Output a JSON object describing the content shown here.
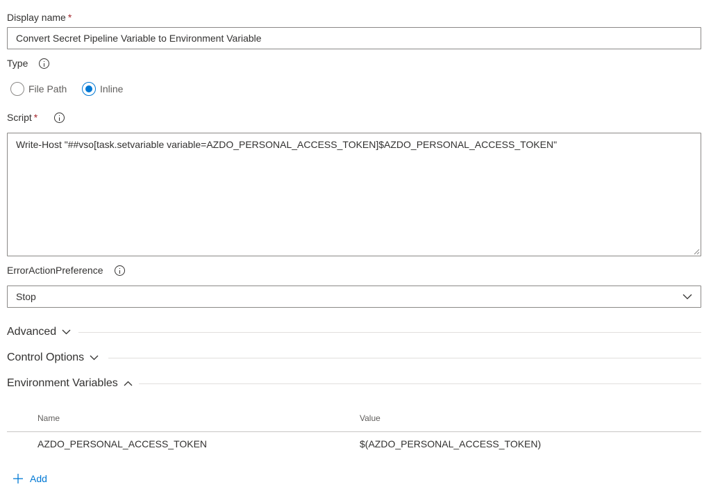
{
  "display_name": {
    "label": "Display name",
    "required_marker": "*",
    "value": "Convert Secret Pipeline Variable to Environment Variable"
  },
  "type": {
    "label": "Type",
    "options": [
      {
        "label": "File Path",
        "selected": false
      },
      {
        "label": "Inline",
        "selected": true
      }
    ]
  },
  "script": {
    "label": "Script",
    "required_marker": "*",
    "value": "Write-Host \"##vso[task.setvariable variable=AZDO_PERSONAL_ACCESS_TOKEN]$AZDO_PERSONAL_ACCESS_TOKEN\""
  },
  "error_action": {
    "label": "ErrorActionPreference",
    "selected": "Stop"
  },
  "sections": {
    "advanced": {
      "label": "Advanced",
      "expanded": false
    },
    "control_options": {
      "label": "Control Options",
      "expanded": false
    },
    "environment_variables": {
      "label": "Environment Variables",
      "expanded": true
    }
  },
  "env_table": {
    "columns": [
      "Name",
      "Value"
    ],
    "rows": [
      {
        "name": "AZDO_PERSONAL_ACCESS_TOKEN",
        "value": "$(AZDO_PERSONAL_ACCESS_TOKEN)"
      }
    ]
  },
  "add_button": {
    "label": "Add"
  },
  "colors": {
    "accent": "#0078d4",
    "border": "#8a8886",
    "required": "#a4262c",
    "divider": "#e1dfdd"
  }
}
